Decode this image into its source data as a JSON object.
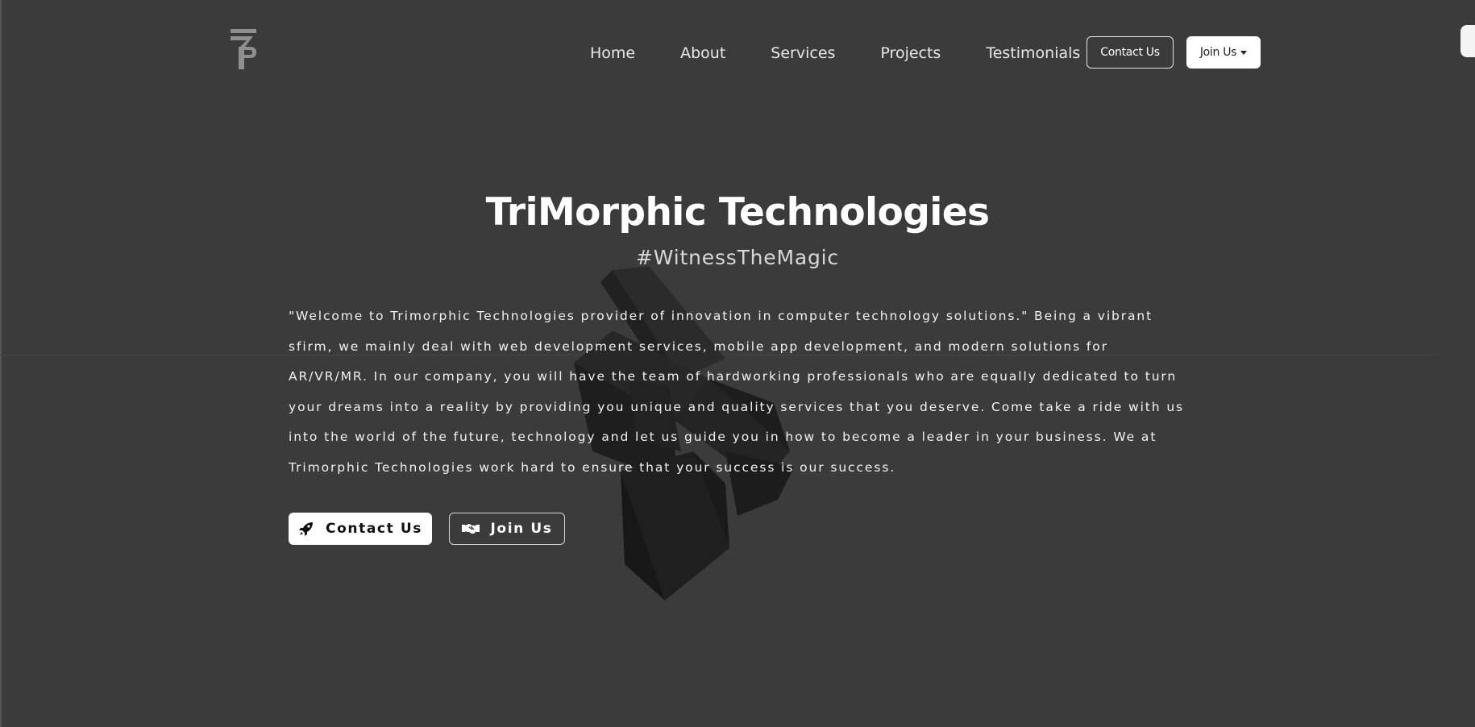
{
  "brand": {
    "logo_icon": "tp-monogram-logo"
  },
  "nav": {
    "links": [
      "Home",
      "About",
      "Services",
      "Projects",
      "Testimonials"
    ],
    "contact_label": "Contact Us",
    "join_label": "Join Us"
  },
  "hero": {
    "title": "TriMorphic Technologies",
    "tagline": "#WitnessTheMagic",
    "body": "\"Welcome to Trimorphic Technologies provider of innovation in computer technology solutions.\" Being a vibrant sfirm, we mainly deal with web development services, mobile app development, and modern solutions for AR/VR/MR. In our company, you will have the team of hardworking professionals who are equally dedicated to turn your dreams into a reality by providing you unique and quality services that you deserve. Come take a ride with us into the world of the future, technology and let us guide you in how to become a leader in your business. We at Trimorphic Technologies work hard to ensure that your success is our success.",
    "contact_button": {
      "label": "Contact Us",
      "icon": "rocket-icon"
    },
    "join_button": {
      "label": "Join Us",
      "icon": "handshake-icon"
    }
  },
  "colors": {
    "background": "#3b3b3b",
    "text": "#ffffff",
    "button_fill": "#ffffff",
    "logo": "#8f8f8f"
  }
}
